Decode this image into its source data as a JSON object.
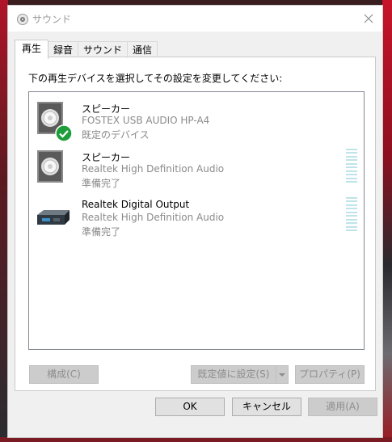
{
  "window": {
    "title": "サウンド",
    "close_glyph": "✕"
  },
  "tabs": [
    {
      "label": "再生",
      "active": true
    },
    {
      "label": "録音",
      "active": false
    },
    {
      "label": "サウンド",
      "active": false
    },
    {
      "label": "通信",
      "active": false
    }
  ],
  "panel": {
    "instruction": "下の再生デバイスを選択してその設定を変更してください:"
  },
  "devices": [
    {
      "name": "スピーカー",
      "description": "FOSTEX USB AUDIO HP-A4",
      "status": "既定のデバイス",
      "icon": "speaker-icon",
      "default": true
    },
    {
      "name": "スピーカー",
      "description": "Realtek High Definition Audio",
      "status": "準備完了",
      "icon": "speaker-icon",
      "default": false
    },
    {
      "name": "Realtek Digital Output",
      "description": "Realtek High Definition Audio",
      "status": "準備完了",
      "icon": "digital-output-icon",
      "default": false
    }
  ],
  "panel_buttons": {
    "configure": "構成(C)",
    "set_default": "既定値に設定(S)",
    "properties": "プロパティ(P)"
  },
  "dialog_buttons": {
    "ok": "OK",
    "cancel": "キャンセル",
    "apply": "適用(A)"
  },
  "colors": {
    "meter": "#bfe3ea",
    "check": "#1e9e3a"
  }
}
